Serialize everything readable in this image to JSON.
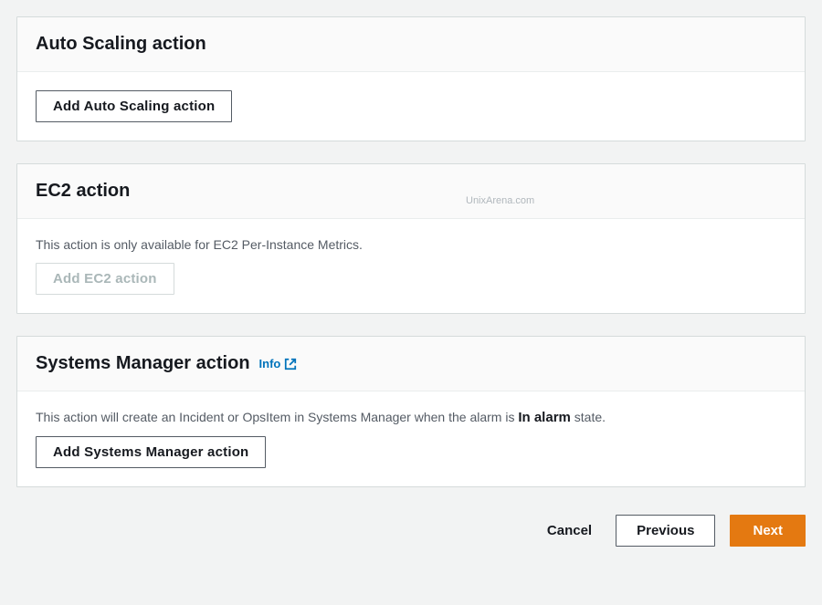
{
  "auto_scaling": {
    "title": "Auto Scaling action",
    "add_button": "Add Auto Scaling action"
  },
  "ec2": {
    "title": "EC2 action",
    "description": "This action is only available for EC2 Per-Instance Metrics.",
    "add_button": "Add EC2 action"
  },
  "systems_manager": {
    "title": "Systems Manager action",
    "info_label": "Info",
    "description_prefix": "This action will create an Incident or OpsItem in Systems Manager when the alarm is ",
    "description_strong": "In alarm",
    "description_suffix": " state.",
    "add_button": "Add Systems Manager action"
  },
  "footer": {
    "cancel": "Cancel",
    "previous": "Previous",
    "next": "Next"
  },
  "watermark": "UnixArena.com"
}
